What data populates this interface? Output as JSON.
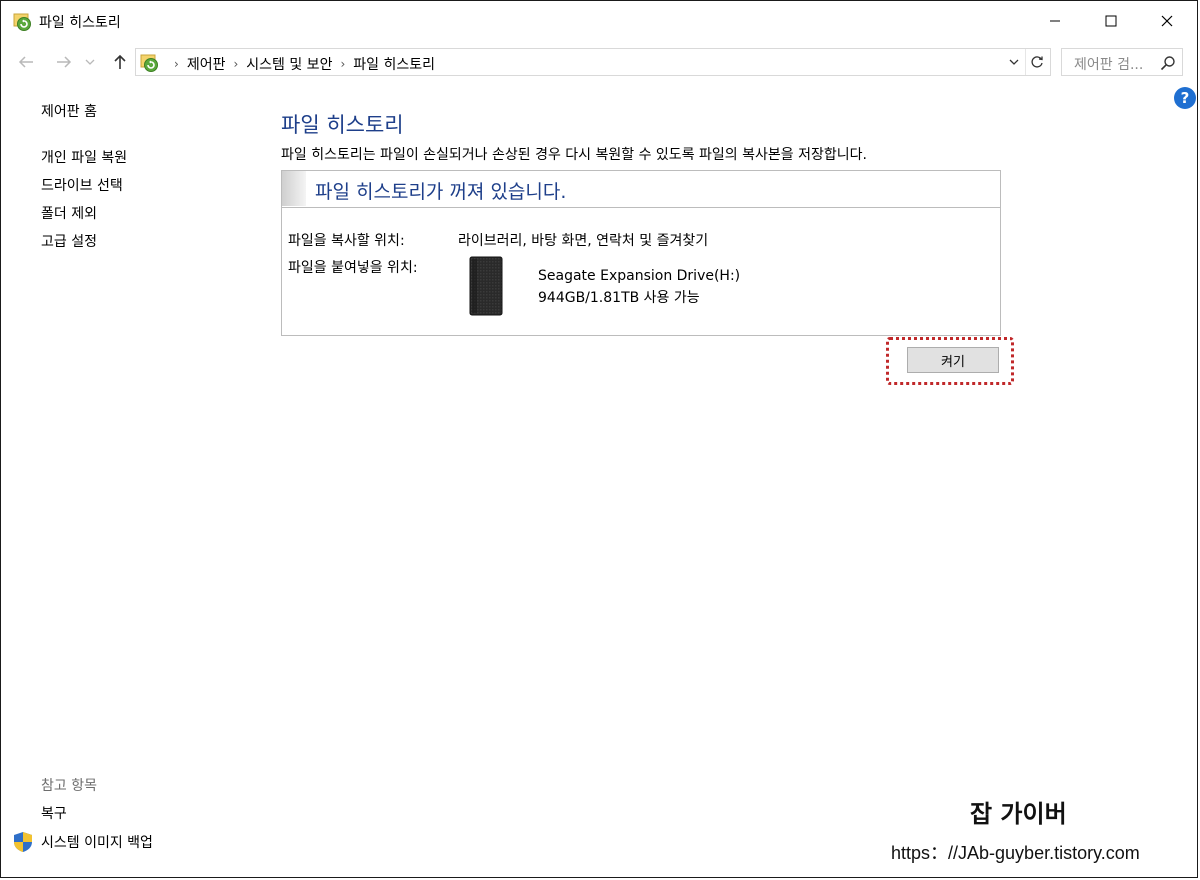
{
  "window": {
    "title": "파일 히스토리"
  },
  "address_bar": {
    "crumbs": [
      "제어판",
      "시스템 및 보안",
      "파일 히스토리"
    ]
  },
  "search": {
    "placeholder": "제어판 검..."
  },
  "sidebar": {
    "home": "제어판 홈",
    "links": [
      "개인 파일 복원",
      "드라이브 선택",
      "폴더 제외",
      "고급 설정"
    ],
    "see_also_heading": "참고 항목",
    "see_also_links": [
      "복구",
      "시스템 이미지 백업"
    ]
  },
  "main": {
    "title": "파일 히스토리",
    "description": "파일 히스토리는 파일이 손실되거나 손상된 경우 다시 복원할 수 있도록 파일의 복사본을 저장합니다.",
    "status_heading": "파일 히스토리가 꺼져 있습니다.",
    "copy_from_label": "파일을 복사할 위치:",
    "copy_from_value": "라이브러리, 바탕 화면, 연락처 및 즐겨찾기",
    "copy_to_label": "파일을 붙여넣을 위치:",
    "drive_name": "Seagate Expansion Drive(H:)",
    "drive_space": "944GB/1.81TB 사용 가능",
    "turn_on_button": "켜기"
  },
  "watermark": {
    "title": "잡 가이버",
    "url": "https：//JAb-guyber.tistory.com"
  },
  "colors": {
    "heading_blue": "#1e3f8a",
    "highlight_red": "#c0282a",
    "help_blue": "#1f6fd1"
  },
  "icons": [
    "file-history-icon",
    "minimize-icon",
    "maximize-icon",
    "close-icon",
    "back-arrow-icon",
    "forward-arrow-icon",
    "recent-dropdown-icon",
    "up-arrow-icon",
    "chevron-down-icon",
    "refresh-icon",
    "search-icon",
    "help-icon",
    "shield-icon",
    "drive-icon"
  ]
}
